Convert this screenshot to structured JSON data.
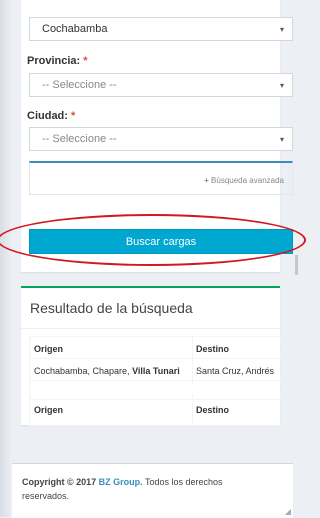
{
  "form": {
    "departamento_value": "Cochabamba",
    "provincia_label": "Provincia:",
    "provincia_placeholder": "-- Seleccione --",
    "ciudad_label": "Ciudad:",
    "ciudad_placeholder": "-- Seleccione --",
    "required_mark": "*",
    "advanced_search_icon": "+",
    "advanced_search_label": "Búsqueda avanzada",
    "search_button_label": "Buscar cargas",
    "caret": "▾"
  },
  "results": {
    "title": "Resultado de la búsqueda",
    "columns": [
      "Origen",
      "Destino"
    ],
    "rows": [
      {
        "origen_prefix": "Cochabamba, Chapare, ",
        "origen_bold": "Villa Tunari",
        "destino": "Santa Cruz, Andrés"
      }
    ],
    "footer_columns": [
      "Origen",
      "Destino"
    ]
  },
  "footer": {
    "copyright_prefix": "Copyright © 2017 ",
    "brand": "BZ Group.",
    "copyright_suffix": " Todos los derechos reservados."
  },
  "colors": {
    "button": "#00a7d0",
    "annotation": "#d4161f",
    "results_border": "#00a65a",
    "accent": "#3c8dbc"
  }
}
